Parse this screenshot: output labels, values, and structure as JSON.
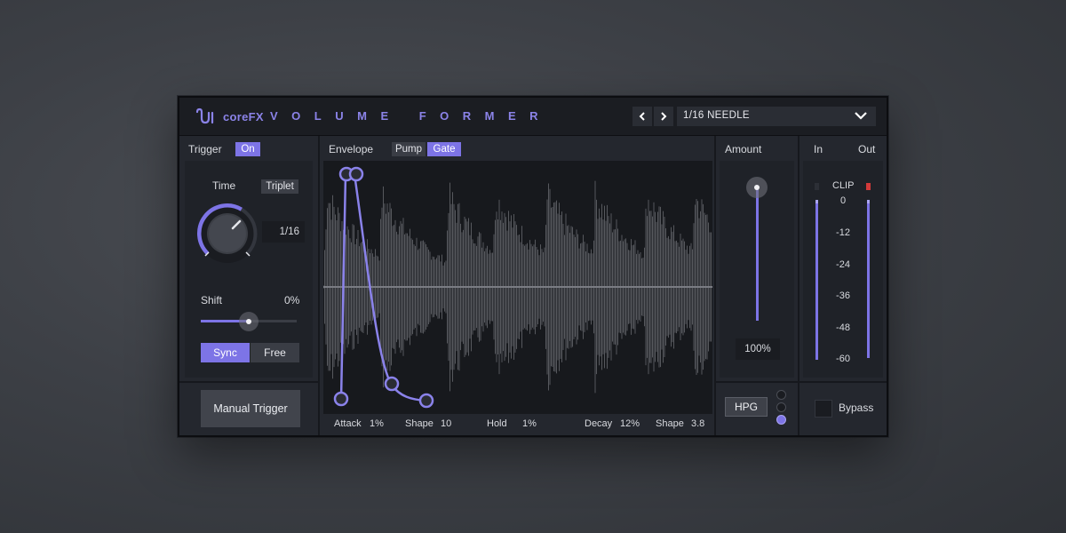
{
  "header": {
    "brand": "coreFX",
    "product": "VOLUME FORMER",
    "preset_name": "1/16 NEEDLE"
  },
  "trigger": {
    "label": "Trigger",
    "on_label": "On",
    "time_label": "Time",
    "triplet_label": "Triplet",
    "time_value": "1/16",
    "shift_label": "Shift",
    "shift_value": "0%",
    "shift_fraction": 0.5,
    "sync_label": "Sync",
    "free_label": "Free",
    "sync_active": true,
    "manual_trigger_label": "Manual Trigger"
  },
  "envelope": {
    "label": "Envelope",
    "pump_label": "Pump",
    "gate_label": "Gate",
    "active_mode": "Gate",
    "params": [
      {
        "name": "Attack",
        "value": "1%"
      },
      {
        "name": "Shape",
        "value": "10"
      },
      {
        "name": "Hold",
        "value": "1%"
      },
      {
        "name": "Decay",
        "value": "12%"
      },
      {
        "name": "Shape",
        "value": "3.8"
      }
    ]
  },
  "amount": {
    "label": "Amount",
    "value": "100%",
    "fraction": 1.0,
    "hpg_label": "HPG"
  },
  "meters": {
    "in_label": "In",
    "out_label": "Out",
    "clip_label": "CLIP",
    "scale": [
      "0",
      "-12",
      "-24",
      "-36",
      "-48",
      "-60"
    ],
    "clip_color": "#d23a3a"
  },
  "bypass": {
    "label": "Bypass"
  },
  "colors": {
    "accent": "#7d74e6",
    "panel": "#24272e",
    "background": "#16181d"
  }
}
